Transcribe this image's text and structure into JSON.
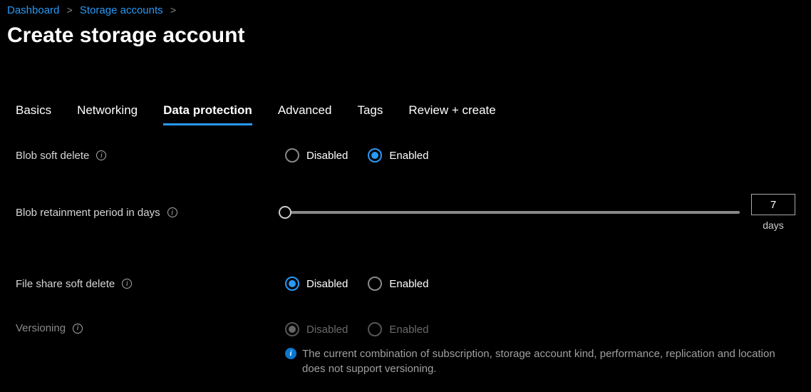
{
  "breadcrumb": {
    "items": [
      "Dashboard",
      "Storage accounts"
    ]
  },
  "page_title": "Create storage account",
  "tabs": [
    "Basics",
    "Networking",
    "Data protection",
    "Advanced",
    "Tags",
    "Review + create"
  ],
  "active_tab": "Data protection",
  "fields": {
    "blob_soft_delete": {
      "label": "Blob soft delete",
      "options": [
        "Disabled",
        "Enabled"
      ],
      "value": "Enabled"
    },
    "blob_retainment": {
      "label": "Blob retainment period in days",
      "value": "7",
      "unit": "days"
    },
    "file_share_soft_delete": {
      "label": "File share soft delete",
      "options": [
        "Disabled",
        "Enabled"
      ],
      "value": "Disabled"
    },
    "versioning": {
      "label": "Versioning",
      "options": [
        "Disabled",
        "Enabled"
      ],
      "value": "Disabled",
      "disabled": true,
      "notice": "The current combination of subscription, storage account kind, performance, replication and location does not support versioning."
    }
  }
}
